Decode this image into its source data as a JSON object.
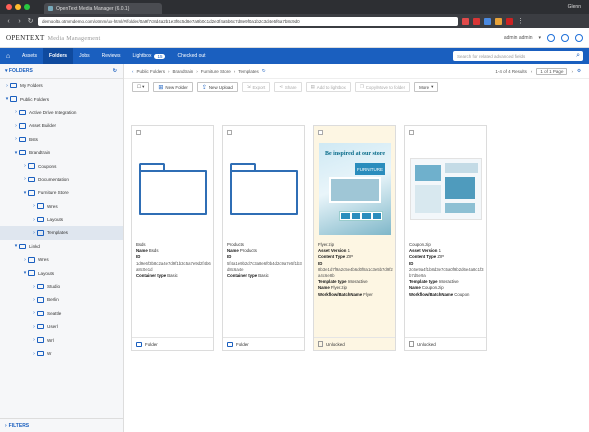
{
  "browser": {
    "tab_title": "OpenText Media Manager (6.0.1)",
    "profile": "Glenn",
    "url": "demooltx.otmmdemo.com/otmm/ux-html/#/folder/0a9f7c8d4a2b1e3f6c5d8e7a9b0c1d2e3f4a5b6c7d8e9f0a1b2c3d4e5f6a7b8c9d0"
  },
  "app": {
    "logo": "OPENTEXT",
    "subtitle": "Media Management",
    "user": "admin admin"
  },
  "nav": {
    "items": [
      "Assets",
      "Folders",
      "Jobs",
      "Reviews",
      "Lightbox",
      "Checked out"
    ],
    "lightbox_count": "15",
    "search_placeholder": "Search for related advanced fields"
  },
  "sidebar": {
    "header": "FOLDERS",
    "footer": "FILTERS",
    "tree": [
      {
        "label": "My Folders",
        "depth": 0,
        "caret": "›"
      },
      {
        "label": "Public Folders",
        "depth": 0,
        "caret": "▾"
      },
      {
        "label": "Active Drive Integration",
        "depth": 1,
        "caret": "›"
      },
      {
        "label": "Asset Builder",
        "depth": 1,
        "caret": "›"
      },
      {
        "label": "Bsts",
        "depth": 1,
        "caret": "›"
      },
      {
        "label": "Brandtrain",
        "depth": 1,
        "caret": "▾"
      },
      {
        "label": "Coupons",
        "depth": 2,
        "caret": "›"
      },
      {
        "label": "Documentation",
        "depth": 2,
        "caret": "›"
      },
      {
        "label": "Furniture Store",
        "depth": 2,
        "caret": "▾"
      },
      {
        "label": "Wres",
        "depth": 3,
        "caret": "›"
      },
      {
        "label": "Layouts",
        "depth": 3,
        "caret": "›"
      },
      {
        "label": "Templates",
        "depth": 3,
        "caret": "›",
        "selected": true
      },
      {
        "label": "Linkd",
        "depth": 1,
        "caret": "▾"
      },
      {
        "label": "Wres",
        "depth": 2,
        "caret": "›"
      },
      {
        "label": "Layouts",
        "depth": 2,
        "caret": "▾"
      },
      {
        "label": "Studio",
        "depth": 3,
        "caret": "›"
      },
      {
        "label": "Berlin",
        "depth": 3,
        "caret": "›"
      },
      {
        "label": "Seattle",
        "depth": 3,
        "caret": "›"
      },
      {
        "label": "Userl",
        "depth": 3,
        "caret": "›"
      },
      {
        "label": "Wrl",
        "depth": 3,
        "caret": "›"
      },
      {
        "label": "W",
        "depth": 3,
        "caret": "›"
      }
    ]
  },
  "breadcrumb": {
    "items": [
      "Public Folders",
      "Brandtrain",
      "Furniture Store",
      "Templates"
    ],
    "results": "1-4 of 4 Results",
    "page_label": "1 of 1 Page"
  },
  "toolbar": {
    "new_folder": "New Folder",
    "new_upload": "New Upload",
    "export": "Export",
    "share": "Share",
    "add_to_lightbox": "Add to lightbox",
    "copy_move": "Copy/Move to folder",
    "more": "More"
  },
  "cards": [
    {
      "kind": "folder",
      "title": "Bsds",
      "name_label": "Name",
      "name": "Bsds",
      "id_label": "ID",
      "id": "1d9e6f3b8c2a4e7d9f1b3c5a7e9d2f4b6a8c0e1d",
      "type_label": "Container type",
      "type": "Basic",
      "footer": "Folder"
    },
    {
      "kind": "folder",
      "title": "Products",
      "name_label": "Name",
      "name": "Products",
      "id_label": "ID",
      "id": "5f4a1e9b2d7c3a8e6f0b4d2c9a7e5f1b3d8c6a4e",
      "type_label": "Container type",
      "type": "Basic",
      "footer": "Folder"
    },
    {
      "kind": "image1",
      "title": "Flyer.zip",
      "av_label": "Asset Version",
      "av": "1",
      "ct_label": "Content Type",
      "ct": "ZIP",
      "id_label": "ID",
      "id": "8b3e1d7f9a2c5e4b6d0f8a1c3e5b7d9f2a4c6e8b",
      "tt_label": "Template type",
      "tt": "Interactive",
      "name_label": "Name",
      "name": "Flyer.zip",
      "wf_label": "Workflow/BatchName",
      "wf": "Flyer",
      "footer": "Unlocked",
      "image_texts": [
        "Be inspired at our store",
        "FURNITURE"
      ]
    },
    {
      "kind": "image2",
      "title": "Coupon.zip",
      "av_label": "Asset Version",
      "av": "1",
      "ct_label": "Content Type",
      "ct": "ZIP",
      "id_label": "ID",
      "id": "2c6e9a4f1b8d3e7c5a0f9b2d6e4a8c1f3b7d5e9a",
      "tt_label": "Template type",
      "tt": "Interactive",
      "name_label": "Name",
      "name": "Coupon.zip",
      "wf_label": "Workflow/BatchName",
      "wf": "Coupon",
      "footer": "Unlocked"
    }
  ],
  "colors": {
    "brand": "#1a5fbf",
    "card_highlight": "#fdf6e3"
  }
}
